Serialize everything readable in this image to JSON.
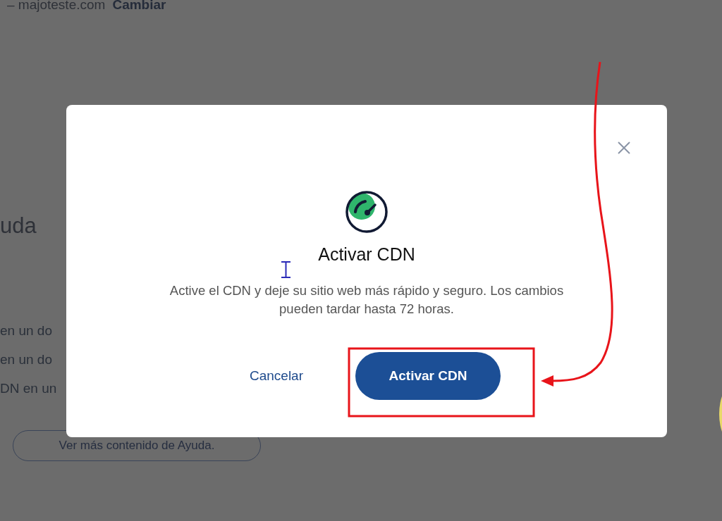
{
  "background": {
    "site": "– majoteste.com",
    "change_link": "Cambiar",
    "heading": "uda",
    "items": [
      "en un do",
      "en un do",
      "DN en un"
    ],
    "more_button": "Ver más contenido de Ayuda."
  },
  "dialog": {
    "title": "Activar CDN",
    "message": "Active el CDN y deje su sitio web más rápido y seguro. Los cambios pueden tardar hasta 72 horas.",
    "cancel": "Cancelar",
    "confirm": "Activar CDN"
  }
}
